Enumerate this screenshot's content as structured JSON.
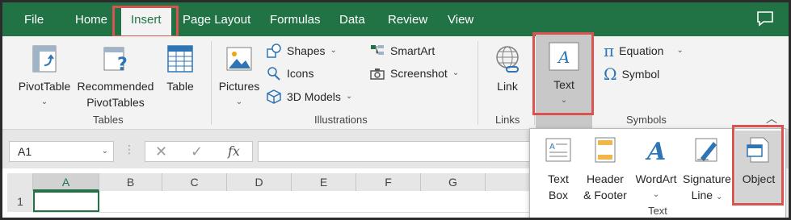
{
  "tabs": [
    {
      "label": "File"
    },
    {
      "label": "Home"
    },
    {
      "label": "Insert"
    },
    {
      "label": "Page Layout"
    },
    {
      "label": "Formulas"
    },
    {
      "label": "Data"
    },
    {
      "label": "Review"
    },
    {
      "label": "View"
    }
  ],
  "ribbon": {
    "tables": {
      "pivot": "PivotTable",
      "recommended_1": "Recommended",
      "recommended_2": "PivotTables",
      "table": "Table",
      "group_label": "Tables"
    },
    "illustrations": {
      "pictures": "Pictures",
      "shapes": "Shapes",
      "icons": "Icons",
      "models": "3D Models",
      "smartart": "SmartArt",
      "screenshot": "Screenshot",
      "group_label": "Illustrations"
    },
    "links": {
      "link": "Link",
      "group_label": "Links"
    },
    "text": {
      "label": "Text"
    },
    "symbols": {
      "equation": "Equation",
      "symbol": "Symbol",
      "group_label": "Symbols"
    }
  },
  "formula_bar": {
    "name_box": "A1",
    "fx": "fx"
  },
  "grid": {
    "columns": [
      "A",
      "B",
      "C",
      "D",
      "E",
      "F",
      "G"
    ],
    "rows": [
      "1"
    ]
  },
  "text_dropdown": {
    "items": [
      {
        "line1": "Text",
        "line2": "Box"
      },
      {
        "line1": "Header",
        "line2": "& Footer"
      },
      {
        "line1": "WordArt",
        "line2": ""
      },
      {
        "line1": "Signature",
        "line2": "Line"
      },
      {
        "line1": "Object",
        "line2": ""
      }
    ],
    "group_label": "Text"
  },
  "colors": {
    "brand": "#217346",
    "highlight": "#d9534f",
    "icon_blue": "#2e75b6"
  }
}
